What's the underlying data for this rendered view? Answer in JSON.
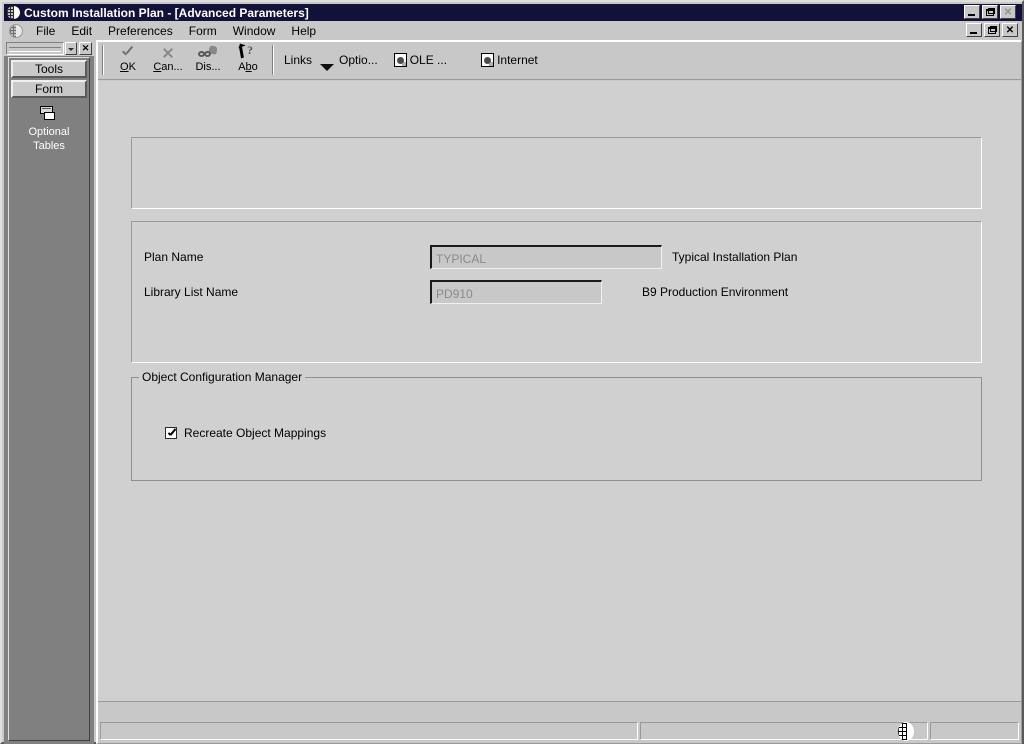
{
  "window": {
    "title": "Custom Installation Plan - [Advanced Parameters]",
    "app_icon": "sphere-icon",
    "outer_controls": [
      {
        "name": "minimize",
        "glyph": "_",
        "enabled": true
      },
      {
        "name": "restore",
        "glyph": "❐",
        "enabled": true
      },
      {
        "name": "close",
        "glyph": "✕",
        "enabled": false
      }
    ],
    "child_controls": [
      {
        "name": "minimize",
        "glyph": "_",
        "enabled": true
      },
      {
        "name": "restore",
        "glyph": "❐",
        "enabled": true
      },
      {
        "name": "close",
        "glyph": "✕",
        "enabled": true
      }
    ]
  },
  "menubar": {
    "icon": "sphere-icon",
    "items": [
      {
        "label": "File"
      },
      {
        "label": "Edit"
      },
      {
        "label": "Preferences"
      },
      {
        "label": "Form"
      },
      {
        "label": "Window"
      },
      {
        "label": "Help"
      }
    ]
  },
  "sidebar": {
    "combo_value": "",
    "close_label": "✕",
    "tabs": [
      {
        "label": "Tools"
      },
      {
        "label": "Form"
      }
    ],
    "entries": [
      {
        "label_line1": "Optional",
        "label_line2": "Tables",
        "icon": "tables-icon"
      }
    ]
  },
  "toolbar": {
    "buttons": [
      {
        "label": "OK",
        "label_pre": "",
        "label_accel": "O",
        "label_post": "K",
        "icon": "check-icon"
      },
      {
        "label": "Can...",
        "label_pre": "",
        "label_accel": "C",
        "label_post": "an...",
        "icon": "close-x-icon"
      },
      {
        "label": "Dis...",
        "label_pre": "Dis...",
        "label_accel": "",
        "label_post": "",
        "icon": "glasses-display-icon"
      },
      {
        "label": "Abo",
        "label_pre": "A",
        "label_accel": "b",
        "label_post": "o",
        "icon": "help-arrow-question-icon"
      }
    ],
    "links_label": "Links",
    "links": [
      {
        "label": "Optio...",
        "icon": "chevron-down-icon"
      },
      {
        "label": "OLE ...",
        "icon": "ole-document-icon"
      },
      {
        "label": "Internet",
        "icon": "internet-document-icon"
      }
    ]
  },
  "form": {
    "top_panel": {
      "content": ""
    },
    "fields": [
      {
        "label": "Plan Name",
        "value": "TYPICAL",
        "placeholder": "",
        "description": "Typical Installation Plan",
        "disabled": true
      },
      {
        "label": "Library List Name",
        "value": "PD910",
        "placeholder": "",
        "description": "B9 Production Environment",
        "disabled": true
      }
    ],
    "groupbox": {
      "title": "Object Configuration Manager",
      "checkboxes": [
        {
          "label_pre": "Recreate Object Mappin",
          "label_accel": "g",
          "label_post": "s",
          "label": "Recreate Object Mappings",
          "checked": true
        }
      ]
    }
  },
  "statusbar": {
    "panels": [
      {
        "text": ""
      },
      {
        "text": ""
      },
      {
        "text": ""
      }
    ],
    "globe_icon": "globe-icon"
  },
  "colors": {
    "titlebar": "#11113a",
    "face": "#c8c8c8",
    "form_face": "#d0d0d0",
    "sidebar": "#808080",
    "disabled_text": "#8a8a8a",
    "text": "#000000"
  }
}
